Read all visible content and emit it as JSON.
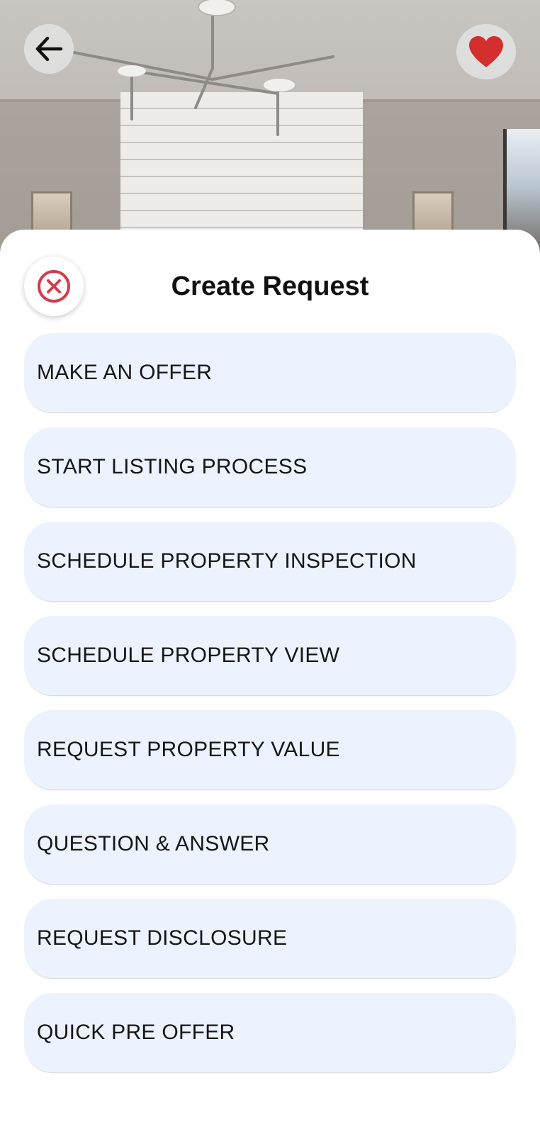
{
  "hero": {
    "image_label": "room-photo"
  },
  "header": {
    "back_icon": "arrow-left-icon",
    "favorite_icon": "heart-icon",
    "favorite_color": "#d32f2f"
  },
  "sheet": {
    "title": "Create Request",
    "close_icon": "close-circle-icon",
    "close_color": "#d23c4d",
    "options": [
      {
        "label": "MAKE AN OFFER"
      },
      {
        "label": "START LISTING PROCESS"
      },
      {
        "label": "SCHEDULE PROPERTY INSPECTION"
      },
      {
        "label": "SCHEDULE PROPERTY VIEW"
      },
      {
        "label": "REQUEST PROPERTY VALUE"
      },
      {
        "label": "QUESTION & ANSWER"
      },
      {
        "label": "REQUEST DISCLOSURE"
      },
      {
        "label": "QUICK PRE OFFER"
      }
    ],
    "option_background": "#edf3fe"
  }
}
